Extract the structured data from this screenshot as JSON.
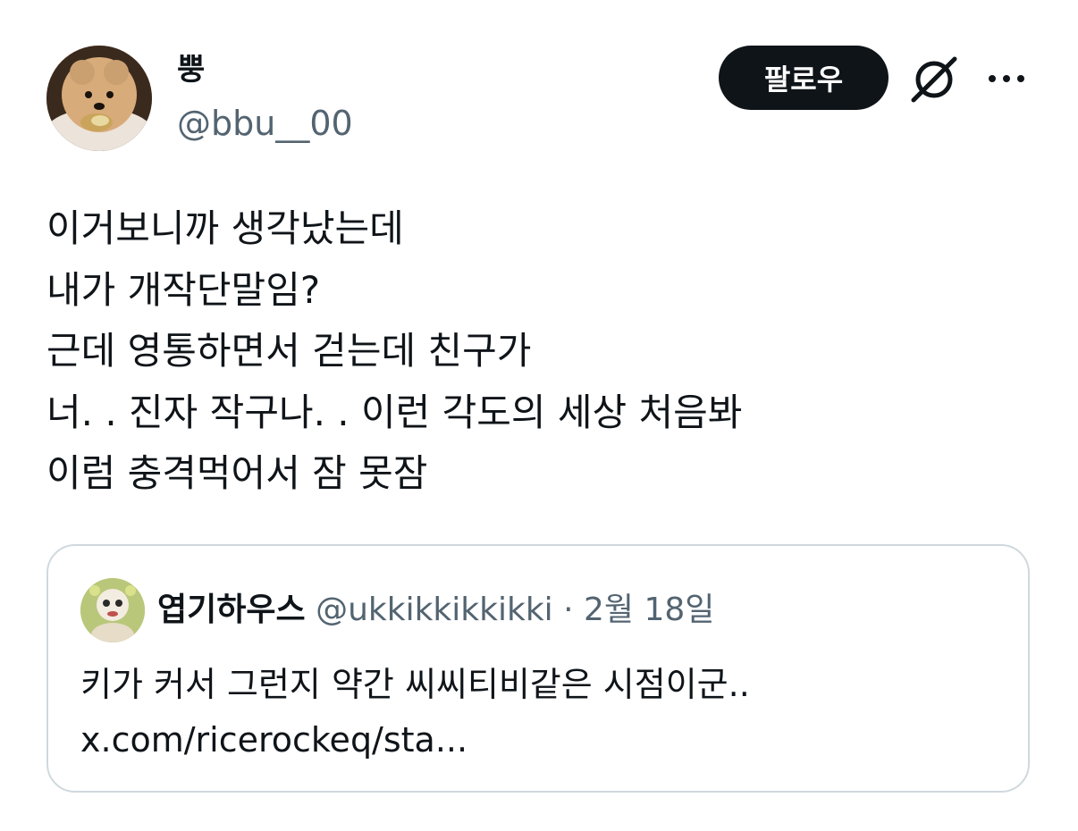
{
  "author": {
    "display_name": "뿡",
    "handle": "@bbu__00",
    "avatar_icon": "pomeranian-dog-avatar"
  },
  "actions": {
    "follow_label": "팔로우",
    "grok_icon": "grok-icon",
    "more_icon": "more-horizontal-icon"
  },
  "tweet": {
    "lines": [
      "이거보니까 생각났는데",
      "내가 개작단말임?",
      "근데 영통하면서 걷는데 친구가",
      "너. . 진자 작구나. . 이런 각도의 세상 처음봐",
      "이럼 충격먹어서 잠 못잠"
    ]
  },
  "quote": {
    "display_name": "엽기하우스",
    "handle": "@ukkikkikkikki",
    "separator": "·",
    "date": "2월 18일",
    "lines": [
      "키가 커서 그런지 약간 씨씨티비같은 시점이군..",
      "x.com/ricerockeq/sta..."
    ],
    "avatar_icon": "character-avatar"
  },
  "colors": {
    "text_primary": "#0f1419",
    "text_secondary": "#536471",
    "border": "#cfd9de",
    "button_bg": "#0f1419",
    "button_text": "#ffffff"
  }
}
